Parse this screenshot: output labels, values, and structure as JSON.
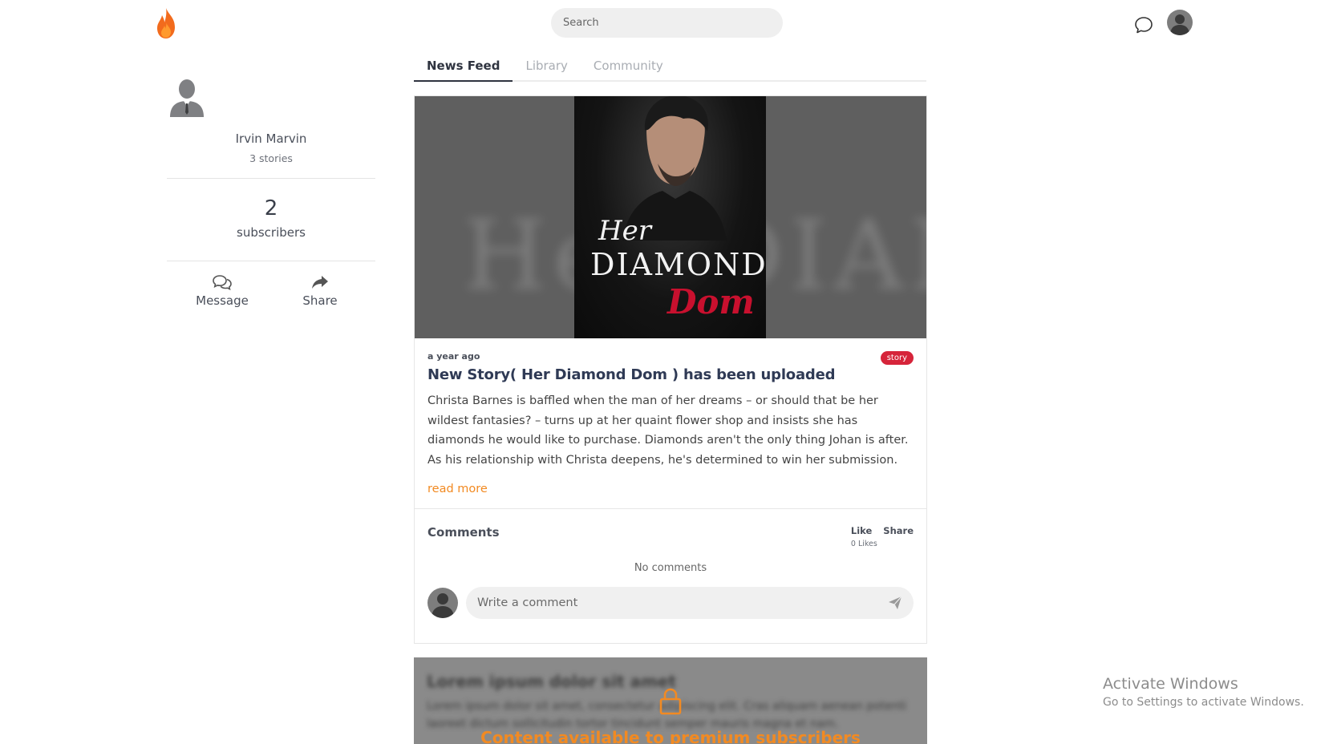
{
  "search": {
    "placeholder": "Search"
  },
  "profile": {
    "name": "Irvin Marvin",
    "stories": "3 stories",
    "subscribers_count": "2",
    "subscribers_label": "subscribers",
    "message_label": "Message",
    "share_label": "Share"
  },
  "tabs": [
    {
      "label": "News Feed",
      "active": true
    },
    {
      "label": "Library",
      "active": false
    },
    {
      "label": "Community",
      "active": false
    }
  ],
  "post": {
    "cover": {
      "line1": "Her",
      "line2": "DIAMOND",
      "line3": "Dom"
    },
    "time": "a year ago",
    "badge": "story",
    "title": "New Story( Her Diamond Dom ) has been uploaded",
    "description": "Christa Barnes is baffled when the man of her dreams – or should that be her wildest fantasies? – turns up at her quaint flower shop and insists she has diamonds he would like to purchase. Diamonds aren't the only thing Johan is after. As his relationship with Christa deepens, he's determined to win her submission.",
    "read_more": "read more",
    "comments_title": "Comments",
    "like_label": "Like",
    "share_label": "Share",
    "likes_count": "0 Likes",
    "no_comments": "No comments",
    "comment_placeholder": "Write a comment"
  },
  "locked_post": {
    "blur_title": "Lorem ipsum dolor sit amet",
    "blur_text": "Lorem ipsum dolor sit amet, consectetur adipiscing elit. Cras aliquam aenean potenti laoreet dictum sollicitudin tortor tincidunt semper mauris magna et nam.",
    "message": "Content available to premium subscribers"
  },
  "watermark": {
    "line1": "Activate Windows",
    "line2": "Go to Settings to activate Windows."
  },
  "colors": {
    "accent_orange": "#f28a22",
    "badge_red": "#d6243a",
    "title_navy": "#2f3a55"
  }
}
